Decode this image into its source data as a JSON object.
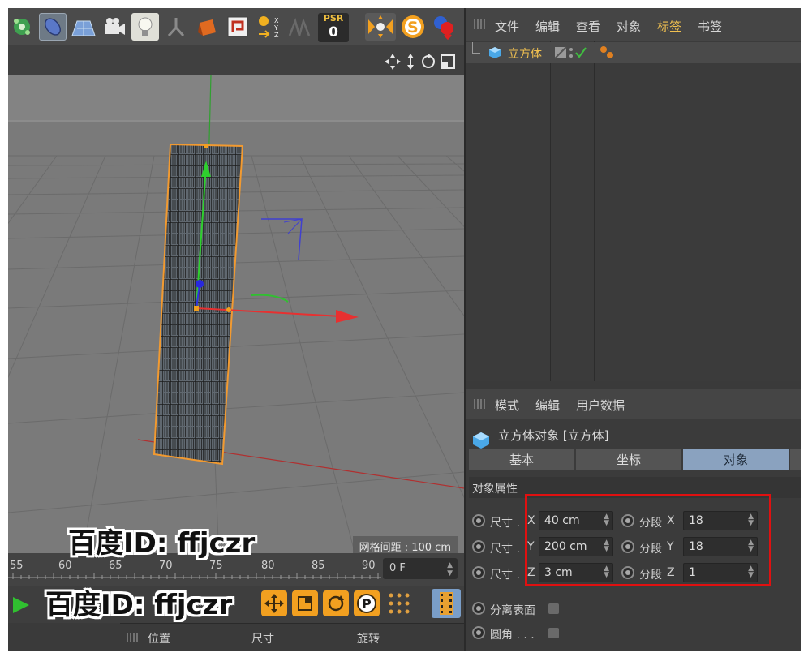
{
  "toolbar": {
    "psr_label": "PSR",
    "psr_value": "0",
    "icons": [
      "mograph-icon",
      "capsule-icon",
      "floor-icon",
      "camera-icon",
      "light-icon",
      "joint-icon",
      "gift-box-icon",
      "render-view-icon",
      "axis-xyz-icon",
      "symmetry-icon",
      "psr-counter",
      "snap-icon",
      "script-s-icon",
      "python-icon"
    ]
  },
  "viewport": {
    "grid_readout": "网格间距 : 100 cm",
    "nav_icons": [
      "move-view-icon",
      "dolly-view-icon",
      "rotate-view-icon",
      "maximize-view-icon"
    ]
  },
  "timeline": {
    "ticks": [
      "55",
      "60",
      "65",
      "70",
      "75",
      "80",
      "85",
      "90"
    ],
    "frame_value": "0 F"
  },
  "coords_bar": {
    "position": "位置",
    "size": "尺寸",
    "rotation": "旋转"
  },
  "object_manager": {
    "menu": [
      "文件",
      "编辑",
      "查看",
      "对象",
      "标签",
      "书签"
    ],
    "highlighted_menu": "标签",
    "object_name": "立方体"
  },
  "attributes": {
    "menu": [
      "模式",
      "编辑",
      "用户数据"
    ],
    "title": "立方体对象 [立方体]",
    "tabs": [
      "基本",
      "坐标",
      "对象"
    ],
    "active_tab": "对象",
    "section": "对象属性",
    "size_label": "尺寸 .",
    "size_rows": [
      {
        "axis": "X",
        "value": "40 cm"
      },
      {
        "axis": "Y",
        "value": "200 cm"
      },
      {
        "axis": "Z",
        "value": "3 cm"
      }
    ],
    "segment_label": "分段",
    "segment_rows": [
      {
        "axis": "X",
        "value": "18"
      },
      {
        "axis": "Y",
        "value": "18"
      },
      {
        "axis": "Z",
        "value": "1"
      }
    ],
    "separate_surfaces": "分离表面",
    "fillet": "圆角 . . ."
  },
  "watermark": {
    "text": "百度ID: ffjczr"
  },
  "colors": {
    "accent_orange": "#f2a020",
    "highlight_yellow": "#f0c050",
    "active_tab": "#8aa2bf",
    "annotation_red": "#e01010"
  }
}
